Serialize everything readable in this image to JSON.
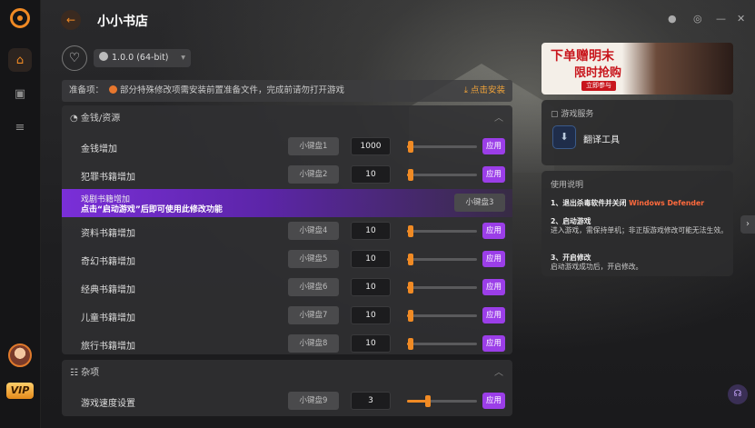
{
  "app": {
    "title": "小小书店"
  },
  "version": {
    "label": "1.0.0 (64-bit)"
  },
  "prep": {
    "label": "准备项：",
    "text": "部分特殊修改项需安装前置准备文件，完成前请勿打开游戏",
    "install": "点击安装"
  },
  "section_money": {
    "title": "金钱/资源",
    "rows": [
      {
        "label": "金钱增加",
        "hotkey": "小键盘1",
        "value": "1000",
        "fill": 0.05,
        "apply": "应用"
      },
      {
        "label": "犯罪书籍增加",
        "hotkey": "小键盘2",
        "value": "10",
        "fill": 0.05,
        "apply": "应用"
      },
      {
        "label": "资料书籍增加",
        "hotkey": "小键盘4",
        "value": "10",
        "fill": 0.05,
        "apply": "应用"
      },
      {
        "label": "奇幻书籍增加",
        "hotkey": "小键盘5",
        "value": "10",
        "fill": 0.05,
        "apply": "应用"
      },
      {
        "label": "经典书籍增加",
        "hotkey": "小键盘6",
        "value": "10",
        "fill": 0.05,
        "apply": "应用"
      },
      {
        "label": "儿童书籍增加",
        "hotkey": "小键盘7",
        "value": "10",
        "fill": 0.05,
        "apply": "应用"
      },
      {
        "label": "旅行书籍增加",
        "hotkey": "小键盘8",
        "value": "10",
        "fill": 0.05,
        "apply": "应用"
      }
    ],
    "locked": {
      "label": "戏剧书籍增加",
      "hint": "点击“启动游戏”后即可使用此修改功能",
      "hotkey": "小键盘3"
    }
  },
  "section_misc": {
    "title": "杂项",
    "rows": [
      {
        "label": "游戏速度设置",
        "hotkey": "小键盘9",
        "value": "3",
        "fill": 0.3,
        "apply": "应用"
      }
    ]
  },
  "banner": {
    "line1": "下单赠明末",
    "line2": "限时抢购",
    "button": "立即参与"
  },
  "service": {
    "title": "游戏服务",
    "tool": "翻译工具"
  },
  "usage": {
    "title": "使用说明",
    "s1": "1、退出杀毒软件并关闭",
    "s1_red": "Windows Defender",
    "s2_title": "2、启动游戏",
    "s2_text": "进入游戏，需保持单机；非正版游戏修改可能无法生效。",
    "s3_title": "3、开启修改",
    "s3_text": "启动游戏成功后，开启修改。"
  },
  "colors": {
    "accent": "#f08a24",
    "apply": "#9b3ee8"
  }
}
